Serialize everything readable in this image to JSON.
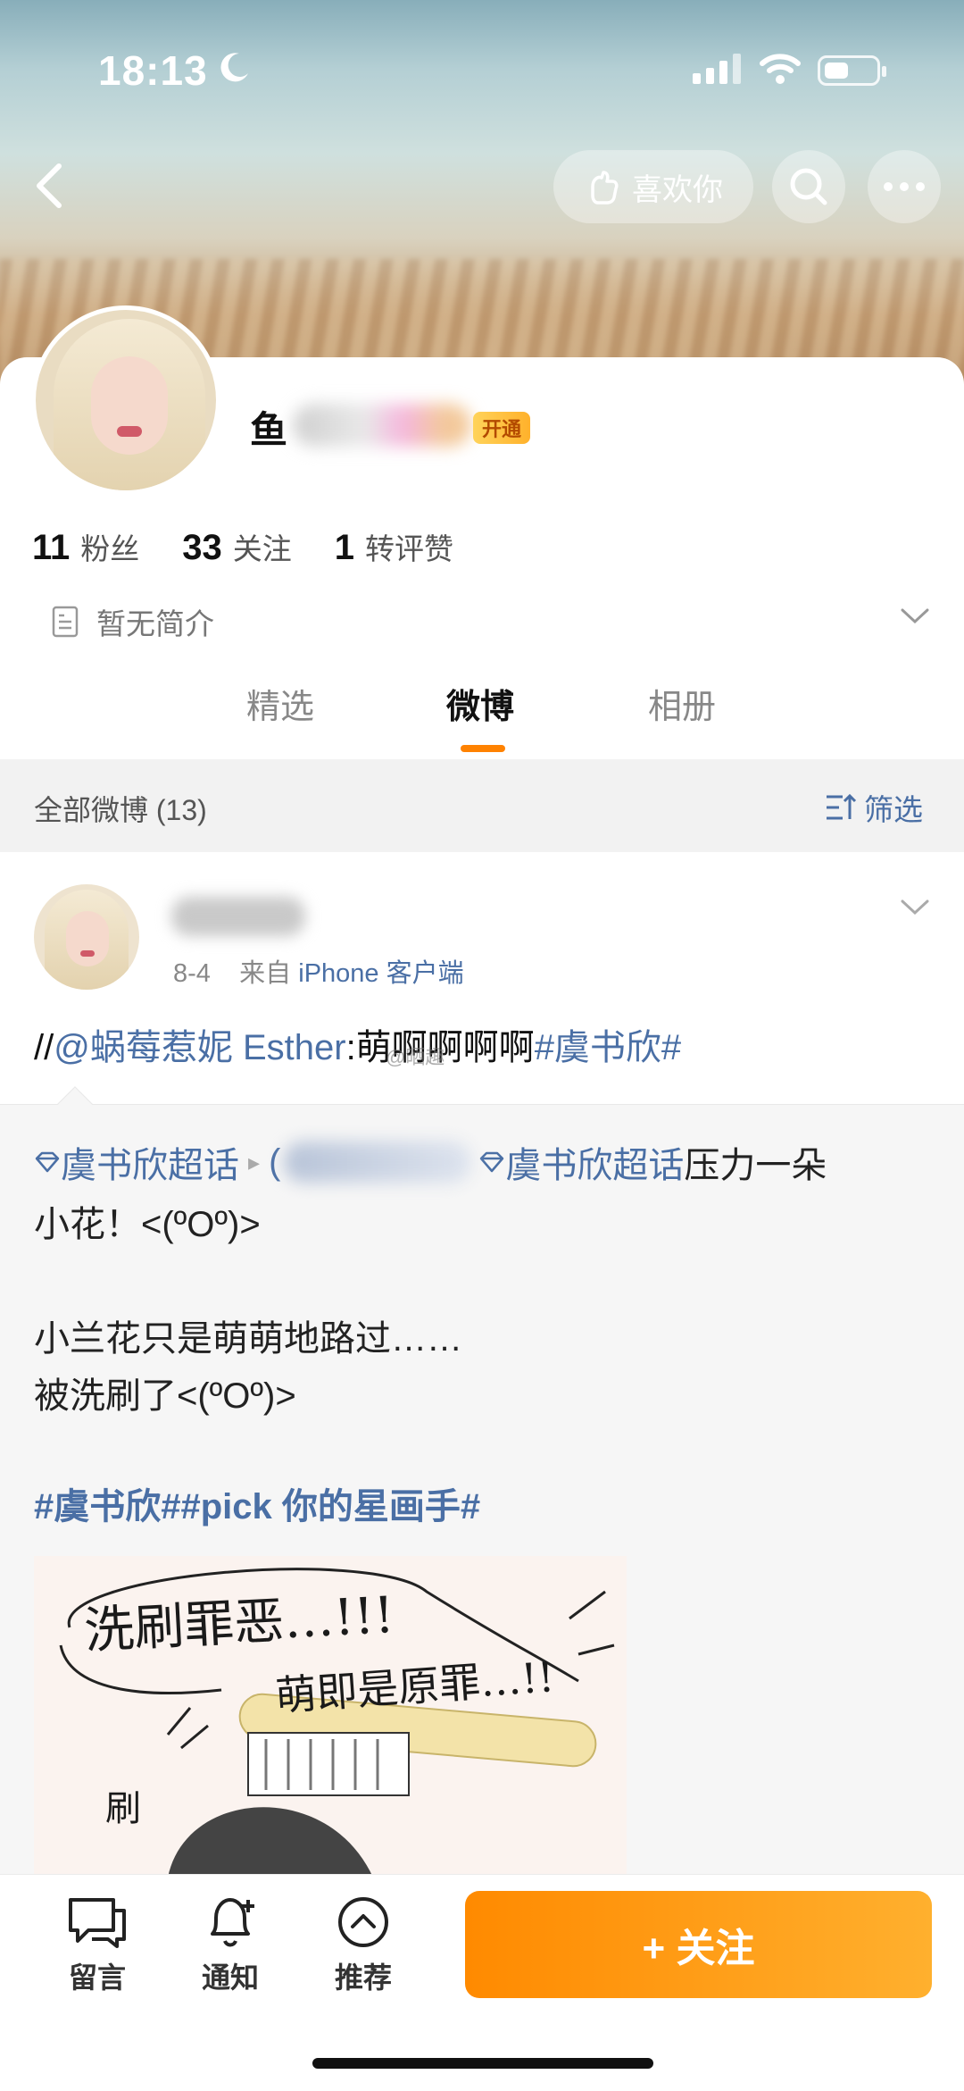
{
  "status_bar": {
    "time": "18:13"
  },
  "header": {
    "like_label": "喜欢你"
  },
  "profile": {
    "name_visible": "鱼",
    "vip_label": "开通",
    "stats": [
      {
        "num": "11",
        "label": "粉丝"
      },
      {
        "num": "33",
        "label": "关注"
      },
      {
        "num": "1",
        "label": "转评赞"
      }
    ],
    "bio": "暂无简介",
    "tabs": [
      {
        "label": "精选",
        "active": false
      },
      {
        "label": "微博",
        "active": true
      },
      {
        "label": "相册",
        "active": false
      }
    ]
  },
  "feed": {
    "count_label": "全部微博 (13)",
    "filter_label": "筛选"
  },
  "post": {
    "date": "8-4",
    "source_prefix": "来自",
    "source": "iPhone 客户端",
    "repost_prefix": "//",
    "repost_mention": "@蜗莓惹妮 Esther",
    "repost_body": ":萌啊啊啊啊",
    "repost_tag": "#虞书欣#",
    "watermark": "@晒趣",
    "original": {
      "topic_1": "虞书欣超话",
      "topic_2": "虞书欣超话",
      "line1_tail": " 压力一朵",
      "line2": "小花！<(ºOº)>",
      "line3": "小兰花只是萌萌地路过……",
      "line4": "被洗刷了<(ºOº)>",
      "tags": "#虞书欣##pick 你的星画手#",
      "image_text_1": "洗刷罪恶…!!!",
      "image_text_2": "萌即是原罪…!!",
      "image_text_3": "刷"
    }
  },
  "bottom_bar": {
    "items": [
      {
        "label": "留言",
        "icon": "chat-icon"
      },
      {
        "label": "通知",
        "icon": "bell-icon"
      },
      {
        "label": "推荐",
        "icon": "up-circle-icon"
      }
    ],
    "follow_label": "+ 关注"
  },
  "colors": {
    "accent": "#ff8200",
    "link": "#4a6fa5"
  }
}
